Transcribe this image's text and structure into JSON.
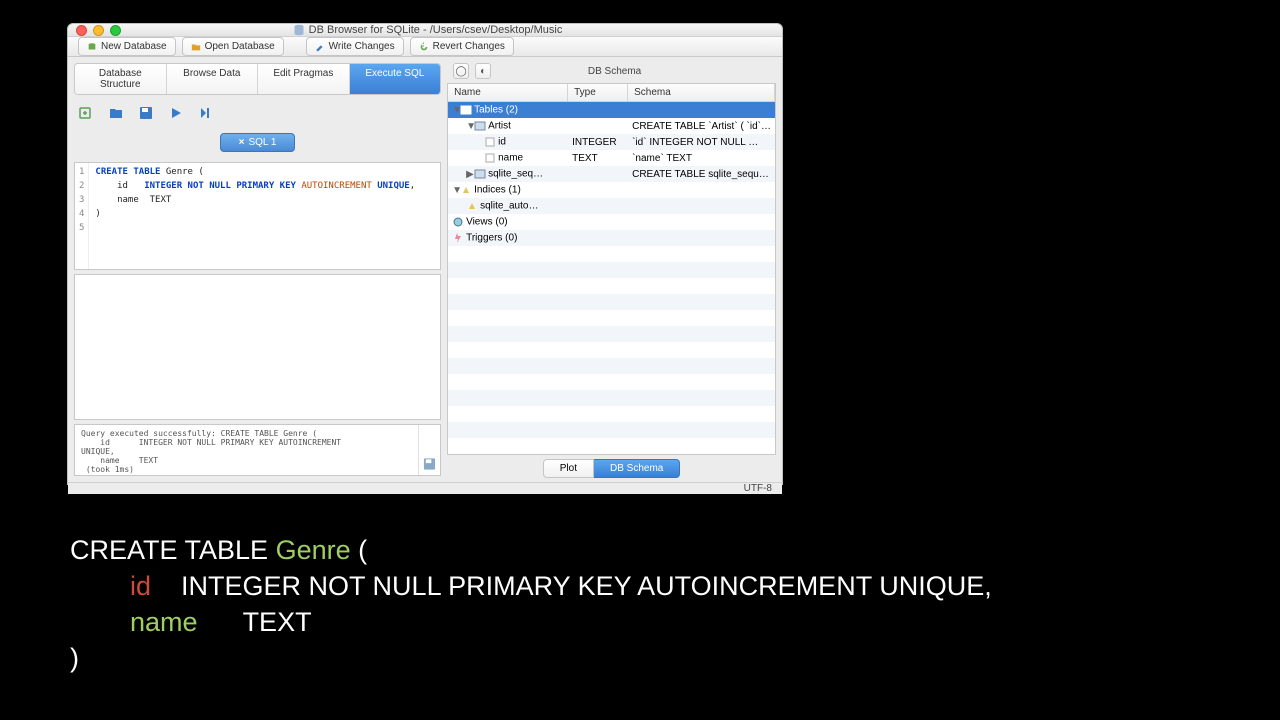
{
  "window": {
    "title": "DB Browser for SQLite - /Users/csev/Desktop/Music"
  },
  "toolbar": {
    "new_db": "New Database",
    "open_db": "Open Database",
    "write": "Write Changes",
    "revert": "Revert Changes"
  },
  "tabs": {
    "structure": "Database Structure",
    "browse": "Browse Data",
    "pragmas": "Edit Pragmas",
    "execute": "Execute SQL"
  },
  "sql_tab": "SQL 1",
  "editor_lines": {
    "l1": "CREATE TABLE Genre (",
    "l2": "    id   INTEGER NOT NULL PRIMARY KEY AUTOINCREMENT UNIQUE,",
    "l3": "    name  TEXT",
    "l4": ")"
  },
  "log": {
    "line1": "Query executed successfully: CREATE TABLE Genre (",
    "line2": "    id      INTEGER NOT NULL PRIMARY KEY AUTOINCREMENT",
    "line3": "UNIQUE,",
    "line4": "    name    TEXT",
    "line5": " (took 1ms)"
  },
  "schema": {
    "header": "DB Schema",
    "cols": {
      "name": "Name",
      "type": "Type",
      "schema": "Schema"
    },
    "rows": {
      "tables": "Tables (2)",
      "artist": "Artist",
      "artist_schema": "CREATE TABLE `Artist` ( `id`…",
      "id": "id",
      "id_type": "INTEGER",
      "id_schema": "`id` INTEGER NOT NULL …",
      "name": "name",
      "name_type": "TEXT",
      "name_schema": "`name` TEXT",
      "sqlite_seq": "sqlite_seq…",
      "sqlite_seq_schema": "CREATE TABLE sqlite_sequ…",
      "indices": "Indices (1)",
      "auto": "sqlite_auto…",
      "views": "Views (0)",
      "triggers": "Triggers (0)"
    },
    "bottom": {
      "plot": "Plot",
      "dbschema": "DB Schema"
    }
  },
  "status": {
    "encoding": "UTF-8"
  },
  "slide_code": {
    "l1a": "CREATE TABLE ",
    "l1b": "Genre",
    "l1c": " (",
    "l2a": "id",
    "l2b": "INTEGER NOT NULL PRIMARY KEY AUTOINCREMENT UNIQUE,",
    "l3a": "name",
    "l3b": "TEXT",
    "l4": ")"
  }
}
